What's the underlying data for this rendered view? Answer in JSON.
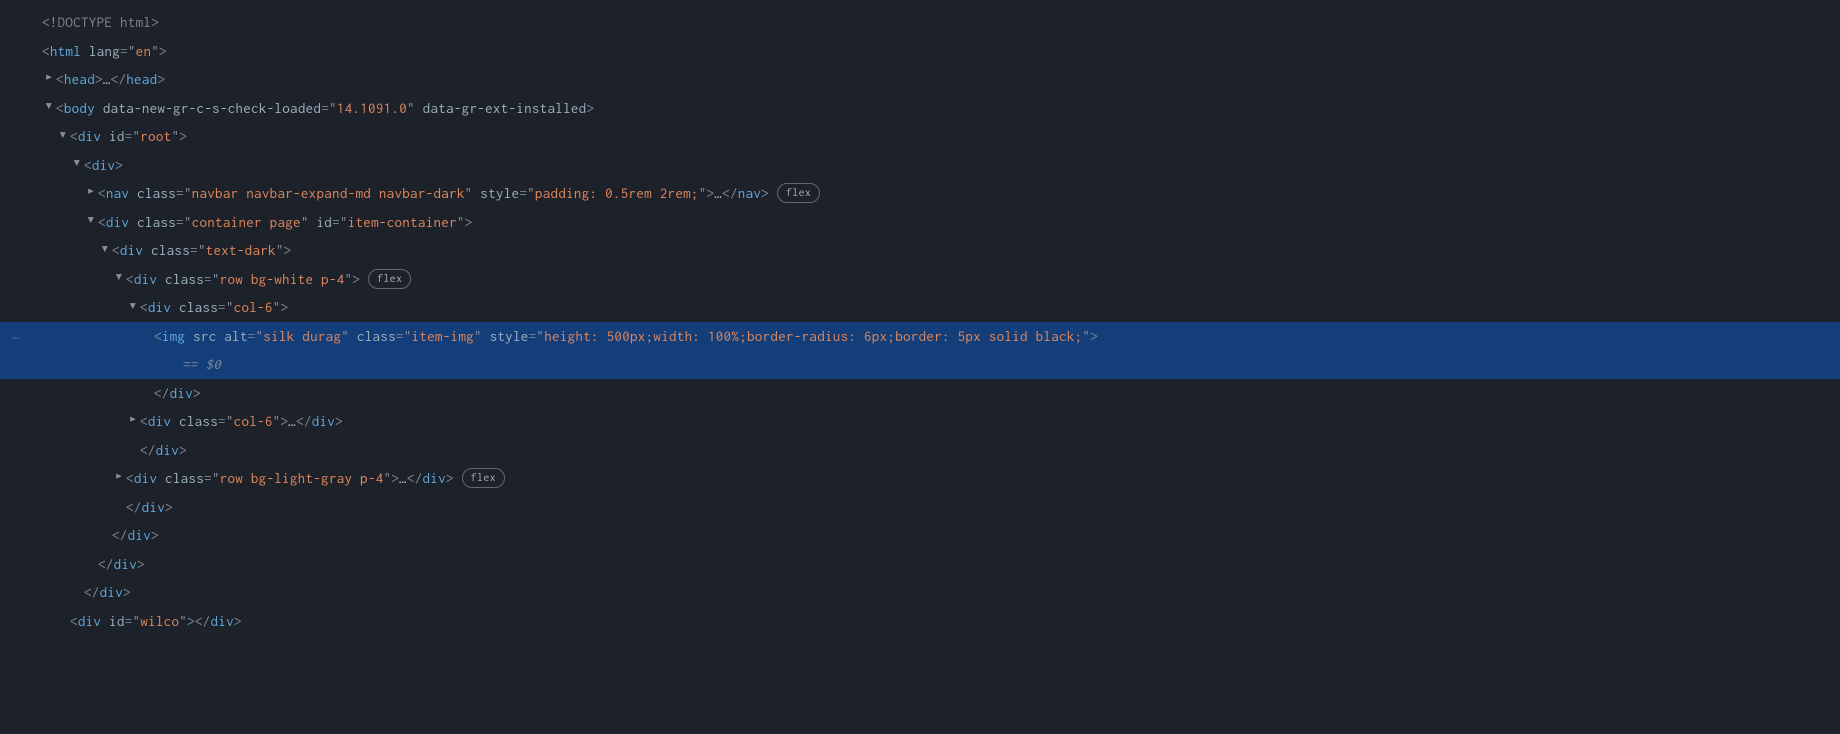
{
  "doctype": "<!DOCTYPE html>",
  "htmlOpen": {
    "tag": "html",
    "attrs": [
      {
        "name": "lang",
        "value": "en"
      }
    ]
  },
  "headCollapsed": {
    "tag": "head"
  },
  "bodyOpen": {
    "tag": "body",
    "attrs": [
      {
        "name": "data-new-gr-c-s-check-loaded",
        "value": "14.1091.0"
      },
      {
        "name": "data-gr-ext-installed",
        "noValue": true
      }
    ]
  },
  "rootDiv": {
    "tag": "div",
    "attrs": [
      {
        "name": "id",
        "value": "root"
      }
    ]
  },
  "innerDiv": {
    "tag": "div"
  },
  "navCollapsed": {
    "tag": "nav",
    "attrs": [
      {
        "name": "class",
        "value": "navbar navbar-expand-md navbar-dark"
      },
      {
        "name": "style",
        "value": "padding: 0.5rem 2rem;"
      }
    ]
  },
  "containerDiv": {
    "tag": "div",
    "attrs": [
      {
        "name": "class",
        "value": "container page"
      },
      {
        "name": "id",
        "value": "item-container"
      }
    ]
  },
  "textDarkDiv": {
    "tag": "div",
    "attrs": [
      {
        "name": "class",
        "value": "text-dark"
      }
    ]
  },
  "rowWhiteDiv": {
    "tag": "div",
    "attrs": [
      {
        "name": "class",
        "value": "row bg-white p-4"
      }
    ]
  },
  "col6aDiv": {
    "tag": "div",
    "attrs": [
      {
        "name": "class",
        "value": "col-6"
      }
    ]
  },
  "imgTag": {
    "tag": "img",
    "attrs": [
      {
        "name": "src",
        "noValue": true
      },
      {
        "name": "alt",
        "value": "silk durag"
      },
      {
        "name": "class",
        "value": "item-img"
      },
      {
        "name": "style",
        "value": "height: 500px;width: 100%;border-radius: 6px;border: 5px solid black;"
      }
    ]
  },
  "consoleRef": "== $0",
  "col6bDiv": {
    "tag": "div",
    "attrs": [
      {
        "name": "class",
        "value": "col-6"
      }
    ]
  },
  "rowGrayDiv": {
    "tag": "div",
    "attrs": [
      {
        "name": "class",
        "value": "row bg-light-gray p-4"
      }
    ]
  },
  "wilcoDiv": {
    "tag": "div",
    "attrs": [
      {
        "name": "id",
        "value": "wilco"
      }
    ]
  },
  "badges": {
    "flex": "flex"
  },
  "toggles": {
    "right": "▶",
    "down": "▼"
  },
  "ellipsis": "…",
  "dots": "…"
}
